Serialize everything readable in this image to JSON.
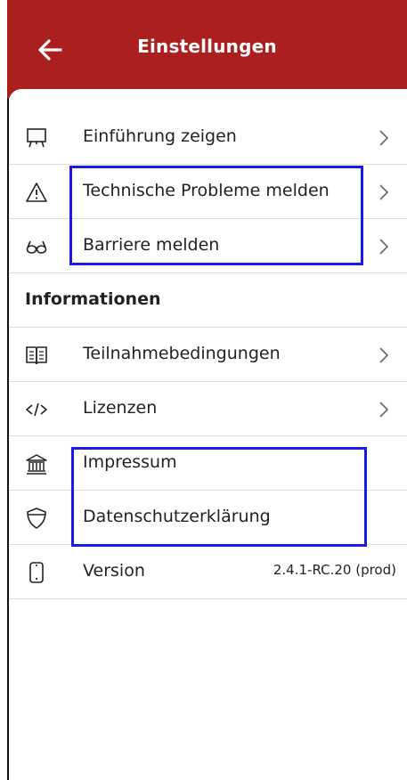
{
  "header": {
    "title": "Einstellungen",
    "back_icon": "arrow-left-icon",
    "background": "#ab1f1f"
  },
  "settings": {
    "intro": {
      "label": "Einführung zeigen",
      "icon": "presentation-icon"
    },
    "tech_problems": {
      "label": "Technische Probleme melden",
      "icon": "warning-triangle-icon"
    },
    "barrier": {
      "label": "Barriere melden",
      "icon": "glasses-icon"
    }
  },
  "info": {
    "heading": "Informationen",
    "terms": {
      "label": "Teilnahmebedingungen",
      "icon": "book-icon"
    },
    "licenses": {
      "label": "Lizenzen",
      "icon": "code-icon"
    },
    "imprint": {
      "label": "Impressum",
      "icon": "building-icon"
    },
    "privacy": {
      "label": "Datenschutzerklärung",
      "icon": "shield-icon"
    },
    "version": {
      "label": "Version",
      "value": "2.4.1-RC.20 (prod)",
      "icon": "smartphone-icon"
    }
  },
  "highlight_color": "#1a1ae6"
}
